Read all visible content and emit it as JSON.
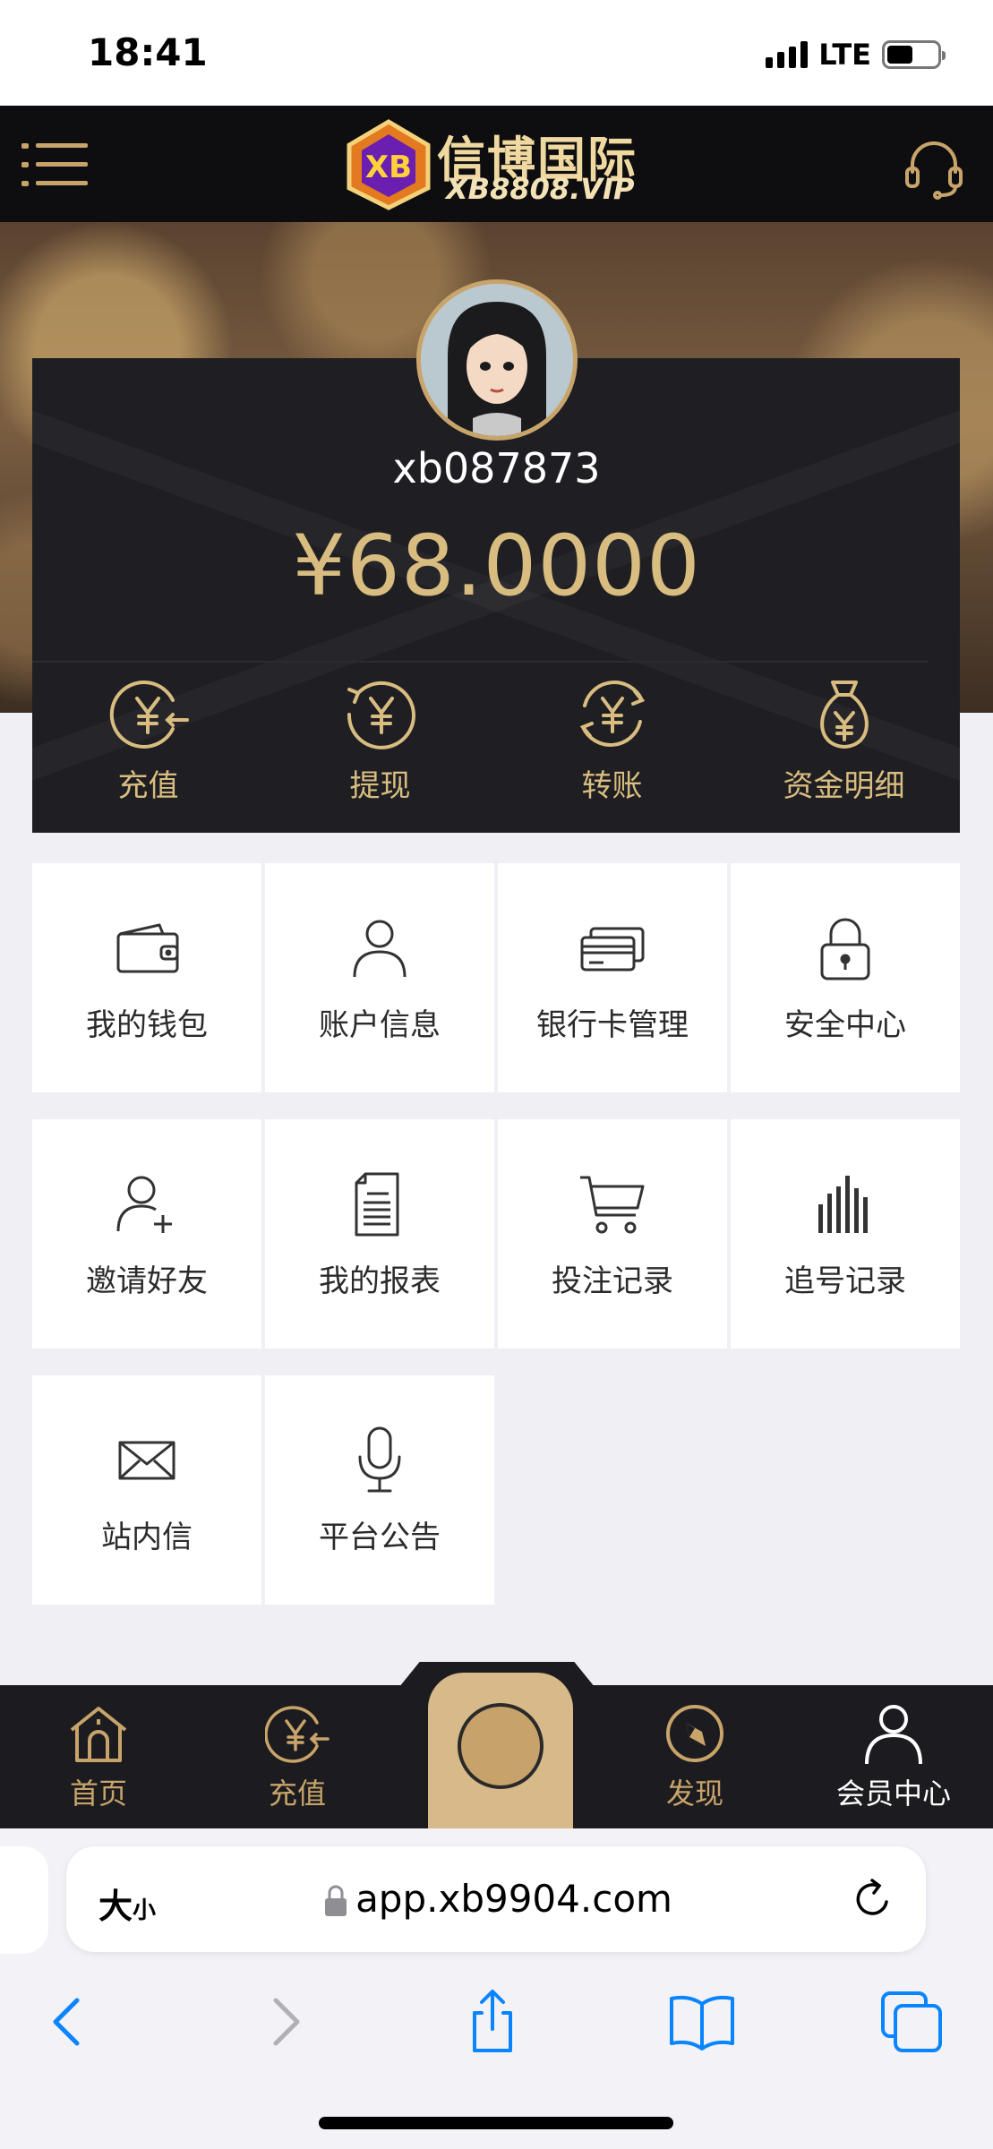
{
  "status_bar": {
    "time": "18:41",
    "network": "LTE"
  },
  "header": {
    "logo_cn": "信博国际",
    "logo_en": "XB8808.VIP",
    "logo_badge": "XB"
  },
  "profile": {
    "username": "xb087873",
    "balance": "¥68.0000"
  },
  "quick_actions": [
    {
      "label": "充值",
      "icon": "yen-in-icon"
    },
    {
      "label": "提现",
      "icon": "yen-withdraw-icon"
    },
    {
      "label": "转账",
      "icon": "yen-transfer-icon"
    },
    {
      "label": "资金明细",
      "icon": "money-bag-icon"
    }
  ],
  "grid": [
    {
      "label": "我的钱包",
      "icon": "wallet-icon"
    },
    {
      "label": "账户信息",
      "icon": "user-icon"
    },
    {
      "label": "银行卡管理",
      "icon": "bank-card-icon"
    },
    {
      "label": "安全中心",
      "icon": "lock-icon"
    },
    {
      "label": "邀请好友",
      "icon": "add-user-icon"
    },
    {
      "label": "我的报表",
      "icon": "report-icon"
    },
    {
      "label": "投注记录",
      "icon": "cart-icon"
    },
    {
      "label": "追号记录",
      "icon": "bars-icon"
    },
    {
      "label": "站内信",
      "icon": "mail-icon"
    },
    {
      "label": "平台公告",
      "icon": "microphone-icon"
    }
  ],
  "tabbar": {
    "home": "首页",
    "recharge": "充值",
    "discover": "发现",
    "member": "会员中心",
    "active": "会员中心"
  },
  "browser": {
    "text_size": "大",
    "text_size_small": "小",
    "url": "app.xb9904.com"
  },
  "colors": {
    "gold": "#d9bd80",
    "dark": "#1f1f23",
    "header": "#0e0e10"
  }
}
